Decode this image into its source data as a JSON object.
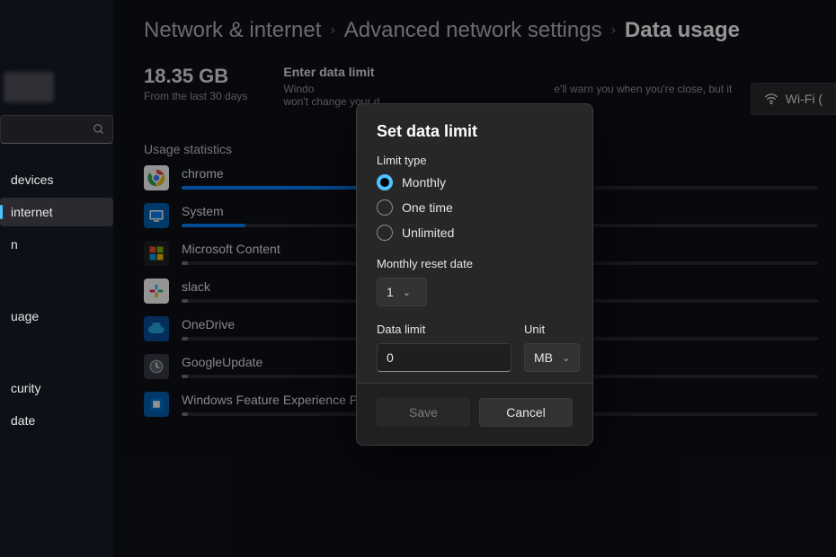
{
  "breadcrumbs": {
    "a": "Network & internet",
    "b": "Advanced network settings",
    "c": "Data usage"
  },
  "summary": {
    "total": "18.35 GB",
    "period": "From the last 30 days"
  },
  "enter_limit": {
    "title": "Enter data limit",
    "desc_left": "Windo",
    "desc_right": "e'll warn you when you're close, but it won't change your d"
  },
  "wifi_button": "Wi-Fi (",
  "sidebar": {
    "items": [
      {
        "label": "devices"
      },
      {
        "label": "internet"
      },
      {
        "label": "n"
      },
      {
        "label": "uage"
      },
      {
        "label": "curity"
      },
      {
        "label": "date"
      }
    ]
  },
  "stats_title": "Usage statistics",
  "stats": [
    {
      "name": "chrome",
      "fill": 64,
      "bar_color": "#0a84ff",
      "icon_bg": "#ffffff",
      "icon_svg": "chrome"
    },
    {
      "name": "System",
      "fill": 10,
      "bar_color": "#0a84ff",
      "icon_bg": "#0063b1",
      "icon_svg": "system"
    },
    {
      "name": "Microsoft Content",
      "fill": 1,
      "bar_color": "#777",
      "icon_bg": "#222",
      "icon_svg": "ms"
    },
    {
      "name": "slack",
      "fill": 1,
      "bar_color": "#777",
      "icon_bg": "#ffffff",
      "icon_svg": "slack"
    },
    {
      "name": "OneDrive",
      "fill": 1,
      "bar_color": "#777",
      "icon_bg": "#0a4f9c",
      "icon_svg": "cloud"
    },
    {
      "name": "GoogleUpdate",
      "fill": 1,
      "bar_color": "#777",
      "icon_bg": "#3a3a47",
      "icon_svg": "update"
    },
    {
      "name": "Windows Feature Experience Pack",
      "fill": 1,
      "bar_color": "#777",
      "icon_bg": "#0063b1",
      "icon_svg": "pack"
    }
  ],
  "dialog": {
    "title": "Set data limit",
    "limit_type_label": "Limit type",
    "options": {
      "monthly": "Monthly",
      "onetime": "One time",
      "unlimited": "Unlimited"
    },
    "reset_label": "Monthly reset date",
    "reset_value": "1",
    "data_limit_label": "Data limit",
    "data_limit_value": "0",
    "unit_label": "Unit",
    "unit_value": "MB",
    "save": "Save",
    "cancel": "Cancel"
  }
}
